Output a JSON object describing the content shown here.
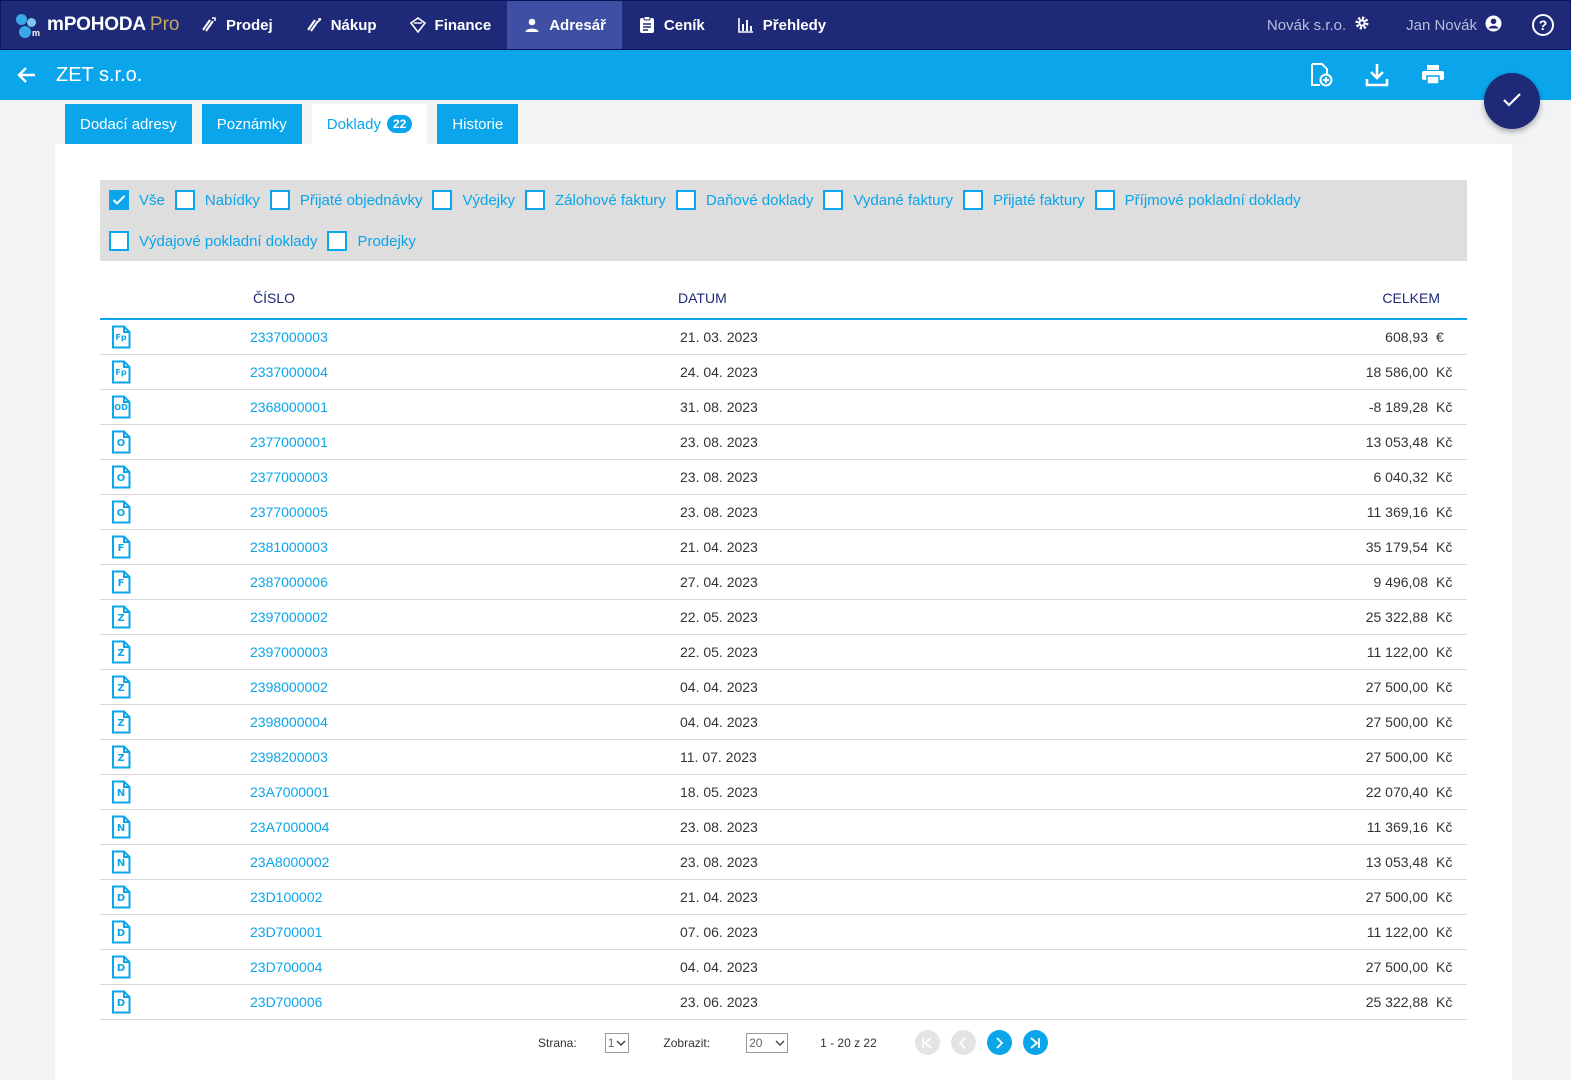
{
  "brand": {
    "name": "mPOHODA",
    "edition": "Pro",
    "logo_mark": "m"
  },
  "nav": [
    {
      "label": "Prodej",
      "icon": "sell-icon"
    },
    {
      "label": "Nákup",
      "icon": "purchase-icon"
    },
    {
      "label": "Finance",
      "icon": "finance-icon"
    },
    {
      "label": "Adresář",
      "icon": "person-icon",
      "active": true
    },
    {
      "label": "Ceník",
      "icon": "pricelist-icon"
    },
    {
      "label": "Přehledy",
      "icon": "chart-icon"
    }
  ],
  "header_right": {
    "company": "Novák s.r.o.",
    "user": "Jan Novák",
    "help": "?"
  },
  "subheader": {
    "title": "ZET s.r.o."
  },
  "tabs": [
    {
      "label": "Dodací adresy"
    },
    {
      "label": "Poznámky"
    },
    {
      "label": "Doklady",
      "badge": "22",
      "active": true
    },
    {
      "label": "Historie"
    }
  ],
  "filters": {
    "row1": [
      {
        "label": "Vše",
        "checked": true
      },
      {
        "label": "Nabídky",
        "checked": false
      },
      {
        "label": "Přijaté objednávky",
        "checked": false
      },
      {
        "label": "Výdejky",
        "checked": false
      },
      {
        "label": "Zálohové faktury",
        "checked": false
      },
      {
        "label": "Daňové doklady",
        "checked": false
      },
      {
        "label": "Vydané faktury",
        "checked": false
      },
      {
        "label": "Přijaté faktury",
        "checked": false
      },
      {
        "label": "Příjmové pokladní doklady",
        "checked": false
      }
    ],
    "row2": [
      {
        "label": "Výdajové pokladní doklady",
        "checked": false
      },
      {
        "label": "Prodejky",
        "checked": false
      }
    ]
  },
  "table": {
    "columns": {
      "number": "ČÍSLO",
      "date": "DATUM",
      "total": "CELKEM"
    },
    "rows": [
      {
        "type": "Fp",
        "number": "2337000003",
        "date": "21. 03. 2023",
        "amount": "608,93",
        "currency": "€"
      },
      {
        "type": "Fp",
        "number": "2337000004",
        "date": "24. 04. 2023",
        "amount": "18 586,00",
        "currency": "Kč"
      },
      {
        "type": "OD",
        "number": "2368000001",
        "date": "31. 08. 2023",
        "amount": "-8 189,28",
        "currency": "Kč"
      },
      {
        "type": "O",
        "number": "2377000001",
        "date": "23. 08. 2023",
        "amount": "13 053,48",
        "currency": "Kč"
      },
      {
        "type": "O",
        "number": "2377000003",
        "date": "23. 08. 2023",
        "amount": "6 040,32",
        "currency": "Kč"
      },
      {
        "type": "O",
        "number": "2377000005",
        "date": "23. 08. 2023",
        "amount": "11 369,16",
        "currency": "Kč"
      },
      {
        "type": "F",
        "number": "2381000003",
        "date": "21. 04. 2023",
        "amount": "35 179,54",
        "currency": "Kč"
      },
      {
        "type": "F",
        "number": "2387000006",
        "date": "27. 04. 2023",
        "amount": "9 496,08",
        "currency": "Kč"
      },
      {
        "type": "Z",
        "number": "2397000002",
        "date": "22. 05. 2023",
        "amount": "25 322,88",
        "currency": "Kč"
      },
      {
        "type": "Z",
        "number": "2397000003",
        "date": "22. 05. 2023",
        "amount": "11 122,00",
        "currency": "Kč"
      },
      {
        "type": "Z",
        "number": "2398000002",
        "date": "04. 04. 2023",
        "amount": "27 500,00",
        "currency": "Kč"
      },
      {
        "type": "Z",
        "number": "2398000004",
        "date": "04. 04. 2023",
        "amount": "27 500,00",
        "currency": "Kč"
      },
      {
        "type": "Z",
        "number": "2398200003",
        "date": "11. 07. 2023",
        "amount": "27 500,00",
        "currency": "Kč"
      },
      {
        "type": "N",
        "number": "23A7000001",
        "date": "18. 05. 2023",
        "amount": "22 070,40",
        "currency": "Kč"
      },
      {
        "type": "N",
        "number": "23A7000004",
        "date": "23. 08. 2023",
        "amount": "11 369,16",
        "currency": "Kč"
      },
      {
        "type": "N",
        "number": "23A8000002",
        "date": "23. 08. 2023",
        "amount": "13 053,48",
        "currency": "Kč"
      },
      {
        "type": "D",
        "number": "23D100002",
        "date": "21. 04. 2023",
        "amount": "27 500,00",
        "currency": "Kč"
      },
      {
        "type": "D",
        "number": "23D700001",
        "date": "07. 06. 2023",
        "amount": "11 122,00",
        "currency": "Kč"
      },
      {
        "type": "D",
        "number": "23D700004",
        "date": "04. 04. 2023",
        "amount": "27 500,00",
        "currency": "Kč"
      },
      {
        "type": "D",
        "number": "23D700006",
        "date": "23. 06. 2023",
        "amount": "25 322,88",
        "currency": "Kč"
      }
    ]
  },
  "pagination": {
    "page_label": "Strana:",
    "page_value": "1",
    "show_label": "Zobrazit:",
    "show_value": "20",
    "range": "1 - 20 z 22"
  },
  "colors": {
    "navy": "#1e2a78",
    "accent": "#0aa5ea",
    "filter_bg": "#dedede"
  }
}
